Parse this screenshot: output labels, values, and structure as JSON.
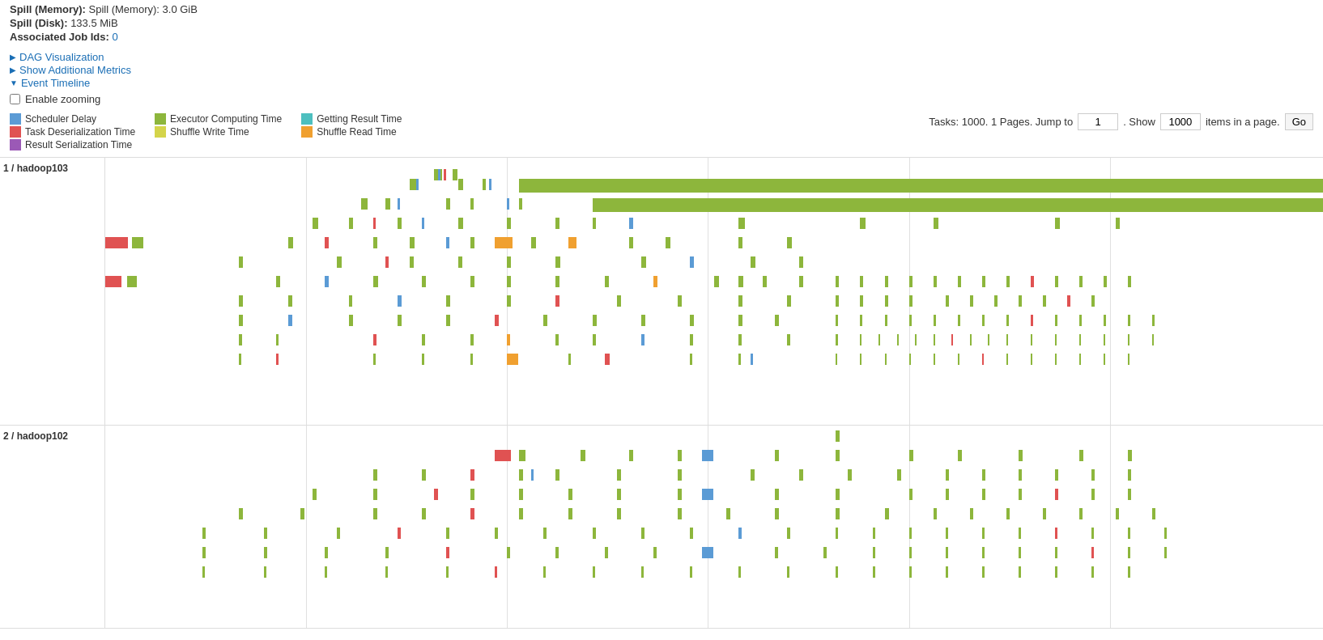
{
  "topInfo": {
    "spillMemory": "Spill (Memory): 3.0 GiB",
    "spillDisk": "Spill (Disk): 133.5 MiB",
    "associatedJobIds": "Associated Job Ids:",
    "jobIdLink": "0"
  },
  "navLinks": [
    {
      "label": "DAG Visualization",
      "arrow": "▶",
      "id": "dag-vis"
    },
    {
      "label": "Show Additional Metrics",
      "arrow": "▶",
      "id": "show-metrics"
    },
    {
      "label": "Event Timeline",
      "arrow": "▼",
      "id": "event-timeline"
    }
  ],
  "enableZooming": {
    "label": "Enable zooming"
  },
  "legend": [
    {
      "label": "Scheduler Delay",
      "colorClass": "col-scheduler"
    },
    {
      "label": "Task Deserialization Time",
      "colorClass": "col-deser"
    },
    {
      "label": "Shuffle Read Time",
      "colorClass": "col-shuffle-read"
    },
    {
      "label": "Executor Computing Time",
      "colorClass": "col-executor"
    },
    {
      "label": "Shuffle Write Time",
      "colorClass": "col-shuffle-write"
    },
    {
      "label": "Result Serialization Time",
      "colorClass": "col-result-ser"
    },
    {
      "label": "Getting Result Time",
      "colorClass": "col-result-get"
    }
  ],
  "pagination": {
    "tasksInfo": "Tasks: 1000. 1 Pages. Jump to",
    "jumpValue": "1",
    "showLabel": ". Show",
    "showValue": "1000",
    "itemsLabel": "items in a page.",
    "goLabel": "Go"
  },
  "executors": [
    {
      "id": "exec1",
      "label": "1 / hadoop103"
    },
    {
      "id": "exec2",
      "label": "2 / hadoop102"
    }
  ]
}
